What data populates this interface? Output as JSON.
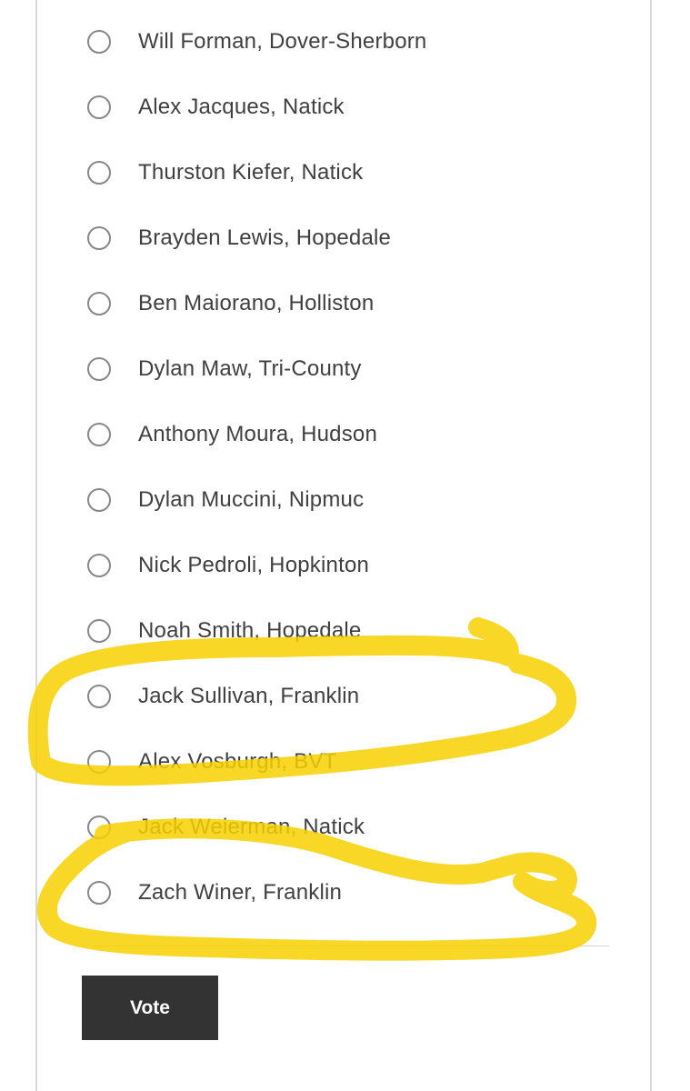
{
  "poll": {
    "options": [
      {
        "label": "Will Forman, Dover-Sherborn",
        "selected": false
      },
      {
        "label": "Alex Jacques, Natick",
        "selected": false
      },
      {
        "label": "Thurston Kiefer, Natick",
        "selected": false
      },
      {
        "label": "Brayden Lewis, Hopedale",
        "selected": false
      },
      {
        "label": "Ben Maiorano, Holliston",
        "selected": false
      },
      {
        "label": "Dylan Maw, Tri-County",
        "selected": false
      },
      {
        "label": "Anthony Moura, Hudson",
        "selected": false
      },
      {
        "label": "Dylan Muccini, Nipmuc",
        "selected": false
      },
      {
        "label": "Nick Pedroli, Hopkinton",
        "selected": false
      },
      {
        "label": "Noah Smith, Hopedale",
        "selected": false
      },
      {
        "label": "Jack Sullivan, Franklin",
        "selected": false
      },
      {
        "label": "Alex Vosburgh, BVT",
        "selected": false
      },
      {
        "label": "Jack Weierman, Natick",
        "selected": false
      },
      {
        "label": "Zach Winer, Franklin",
        "selected": false
      }
    ],
    "vote_label": "Vote"
  },
  "annotations": {
    "highlight_color": "#f7d000",
    "circled_groups": [
      [
        "Jack Sullivan, Franklin",
        "Alex Vosburgh, BVT"
      ],
      [
        "Jack Weierman, Natick",
        "Zach Winer, Franklin"
      ]
    ]
  },
  "theme": {
    "button_color": "#333333",
    "text_color": "#3f3f3f",
    "radio_border": "#888888"
  }
}
